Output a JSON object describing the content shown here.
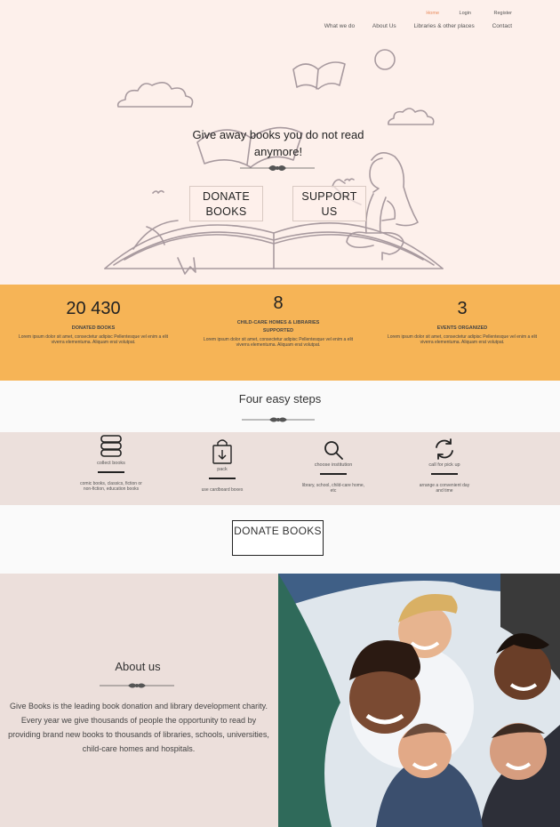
{
  "nav": {
    "top": {
      "home": "Home",
      "login": "Login",
      "register": "Register"
    },
    "main": [
      "What we do",
      "About Us",
      "Libraries & other places",
      "Contact"
    ]
  },
  "hero": {
    "title": "Give away books you do not read anymore!",
    "donate_label": "DONATE BOOKS",
    "support_label": "SUPPORT US"
  },
  "stats": [
    {
      "value": "20 430",
      "label": "DONATED BOOKS",
      "desc": "Lorem ipsum dolor sit amet, consectetur adipisc Pellentesque vel enim a elit viverra elementuma. Aliquam erat volutpat."
    },
    {
      "value": "8",
      "label": "CHILD-CARE HOMES & LIBRARIES SUPPORTED",
      "desc": "Lorem ipsum dolor sit amet, consectetur adipisc Pellentesque vel enim a elit viverra elementuma. Aliquam erat volutpat."
    },
    {
      "value": "3",
      "label": "EVENTS ORGANIZED",
      "desc": "Lorem ipsum dolor sit amet, consectetur adipisc Pellentesque vel enim a elit viverra elementuma. Aliquam erat volutpat."
    }
  ],
  "steps_title": "Four easy steps",
  "steps": [
    {
      "icon": "books-stack-icon",
      "label": "collect books",
      "desc": "comic books, classics, fiction or non-fiction, education books"
    },
    {
      "icon": "shopping-bag-icon",
      "label": "pack",
      "desc": "use cardboard boxes"
    },
    {
      "icon": "search-icon",
      "label": "choose institution",
      "desc": "library, school, child-care home, etc"
    },
    {
      "icon": "refresh-icon",
      "label": "call for pick up",
      "desc": "arrange a convenient day and time"
    }
  ],
  "donate_cta": "DONATE BOOKS",
  "about": {
    "title": "About us",
    "text": "Give Books is the leading book donation and library development charity. Every year we give thousands of people the opportunity to read by providing brand new books to thousands of libraries, schools, universities, child-care homes and hospitals."
  },
  "colors": {
    "hero_bg": "#fdf0eb",
    "stats_bg": "#f6b456",
    "steps_bg": "#ece0dc",
    "accent": "#e8895a"
  }
}
